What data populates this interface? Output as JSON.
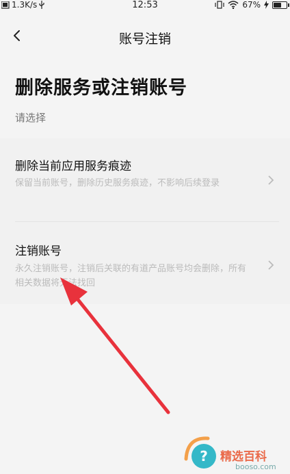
{
  "status_bar": {
    "network_speed": "1.3K/s",
    "time": "12:53",
    "battery_percent": "67%",
    "battery_level": 0.67
  },
  "nav": {
    "title": "账号注销",
    "back_icon": "chevron-left-icon"
  },
  "page": {
    "title": "删除服务或注销账号",
    "subtitle": "请选择"
  },
  "options": [
    {
      "title": "删除当前应用服务痕迹",
      "description": "保留当前账号，删除历史服务痕迹，不影响后续登录",
      "icon": "chevron-right-icon"
    },
    {
      "title": "注销账号",
      "description": "永久注销账号，注销后关联的有道产品账号均会删除，所有相关数据将无法找回",
      "icon": "chevron-right-icon"
    }
  ],
  "watermark": {
    "text": "精选百科",
    "domain": "booso.com",
    "icon": "question-circle-icon"
  },
  "colors": {
    "annotation_arrow": "#e8323c",
    "background": "#f4f4f4"
  }
}
